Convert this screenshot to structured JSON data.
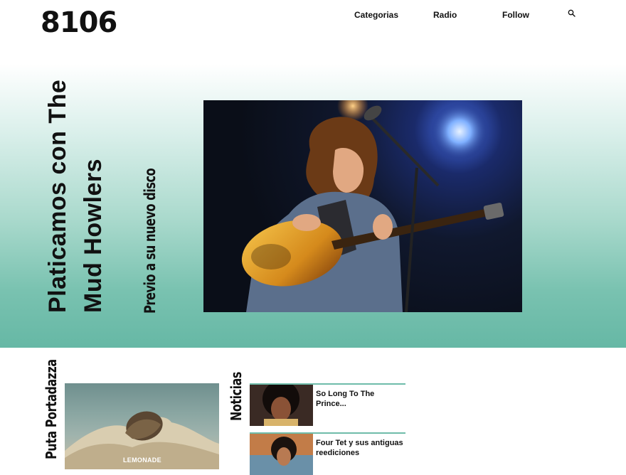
{
  "header": {
    "logo": "8106",
    "nav": [
      "Categorias",
      "Radio",
      "Follow"
    ],
    "search_icon": "search-icon"
  },
  "hero": {
    "title_line_1": "Platicamos con The",
    "title_line_2": "Mud Howlers",
    "subtitle": "Previo a su nuevo disco",
    "background_colors": [
      "#ffffff",
      "#66b8a5"
    ]
  },
  "sections": {
    "left_label": "Puta Portadazza",
    "cover_text": "LEMONADE",
    "mid_label": "Noticias"
  },
  "news": [
    {
      "title": "So Long To The Prince..."
    },
    {
      "title": "Four Tet y sus antiguas reediciones"
    }
  ],
  "colors": {
    "accent": "#6fbcaa"
  }
}
